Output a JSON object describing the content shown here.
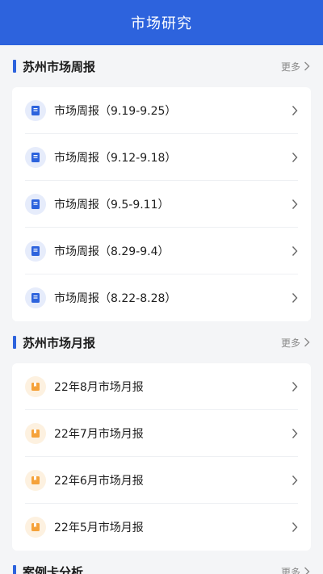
{
  "header": {
    "title": "市场研究"
  },
  "weekly": {
    "title": "苏州市场周报",
    "more": "更多",
    "items": [
      {
        "label": "市场周报（9.19-9.25）"
      },
      {
        "label": "市场周报（9.12-9.18）"
      },
      {
        "label": "市场周报（9.5-9.11）"
      },
      {
        "label": "市场周报（8.29-9.4）"
      },
      {
        "label": "市场周报（8.22-8.28）"
      }
    ]
  },
  "monthly": {
    "title": "苏州市场月报",
    "more": "更多",
    "items": [
      {
        "label": "22年8月市场月报"
      },
      {
        "label": "22年7月市场月报"
      },
      {
        "label": "22年6月市场月报"
      },
      {
        "label": "22年5月市场月报"
      }
    ]
  },
  "cases": {
    "title": "案例卡分析",
    "more": "更多"
  },
  "colors": {
    "accent": "#2d63dd",
    "weekly_icon": "#2d63dd",
    "monthly_icon": "#f5a23a"
  },
  "icons": {
    "weekly_item": "notebook-icon",
    "monthly_item": "bookmark-book-icon",
    "row_arrow": "chevron-right-icon"
  }
}
